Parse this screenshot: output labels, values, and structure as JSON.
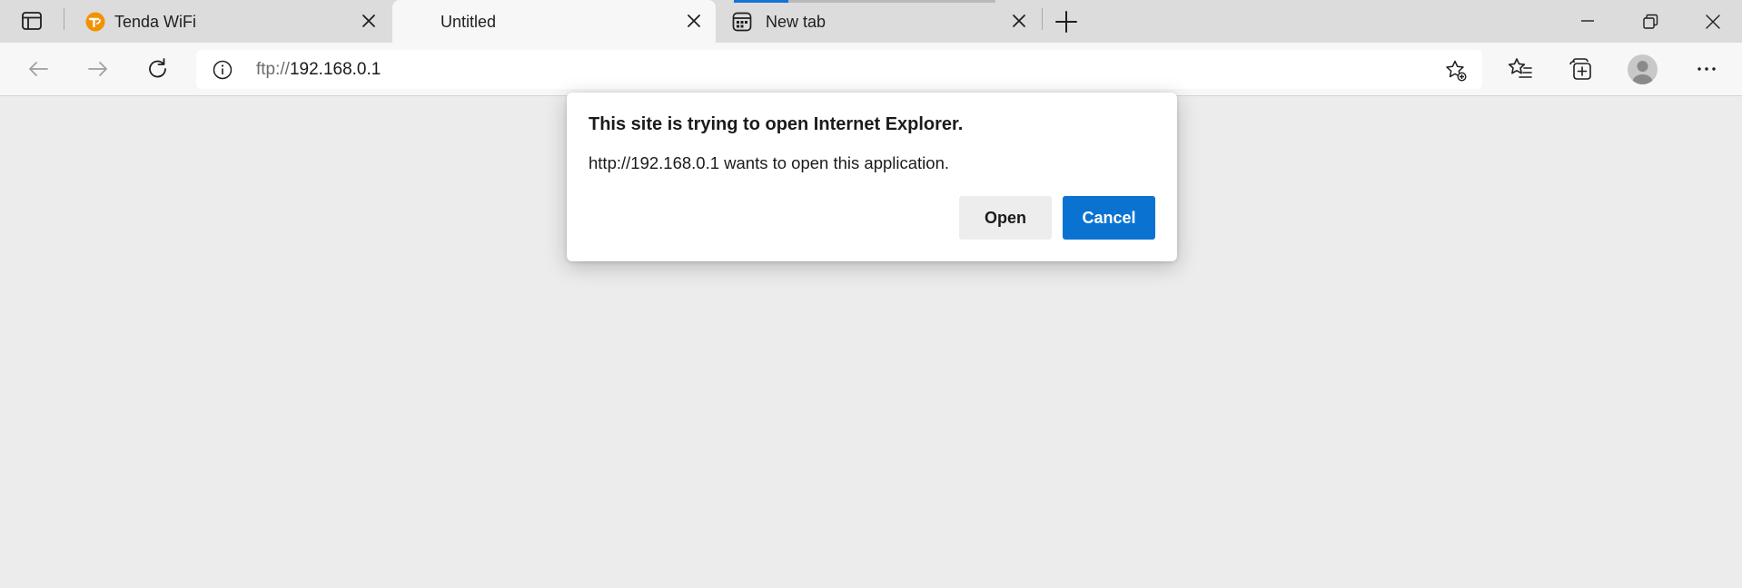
{
  "browser": {
    "tabs": [
      {
        "title": "Tenda WiFi",
        "favicon": "tenda-logo-icon",
        "active": false
      },
      {
        "title": "Untitled",
        "favicon": "",
        "active": true
      },
      {
        "title": "New tab",
        "favicon": "new-tab-page-icon",
        "active": false
      }
    ],
    "address_bar": {
      "url_scheme": "ftp://",
      "url_host": "192.168.0.1"
    },
    "colors": {
      "accent": "#0a73d1",
      "tenda_orange": "#f39200"
    }
  },
  "dialog": {
    "title": "This site is trying to open Internet Explorer.",
    "message": "http://192.168.0.1 wants to open this application.",
    "open_label": "Open",
    "cancel_label": "Cancel"
  }
}
